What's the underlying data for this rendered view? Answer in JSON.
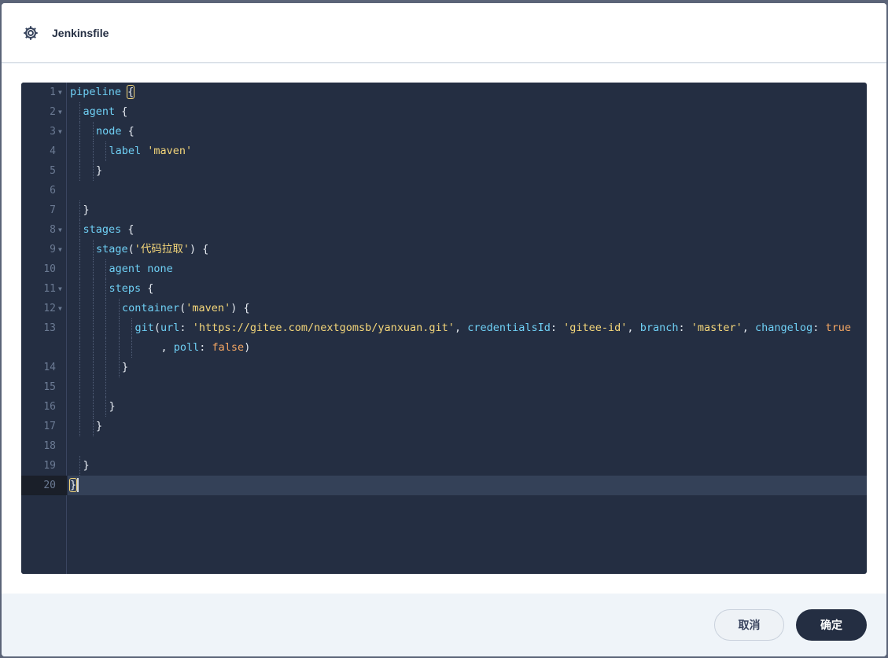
{
  "header": {
    "icon": "gear-icon",
    "title": "Jenkinsfile"
  },
  "editor": {
    "active_line": 20,
    "lines": [
      {
        "num": "1",
        "fold": true,
        "indent": 0,
        "tokens": [
          [
            "k",
            "pipeline"
          ],
          [
            "p",
            " "
          ],
          [
            "hl",
            "{"
          ]
        ]
      },
      {
        "num": "2",
        "fold": true,
        "indent": 1,
        "tokens": [
          [
            "k",
            "agent"
          ],
          [
            "p",
            " {"
          ]
        ]
      },
      {
        "num": "3",
        "fold": true,
        "indent": 2,
        "tokens": [
          [
            "k",
            "node"
          ],
          [
            "p",
            " {"
          ]
        ]
      },
      {
        "num": "4",
        "fold": false,
        "indent": 3,
        "tokens": [
          [
            "k",
            "label"
          ],
          [
            "p",
            " "
          ],
          [
            "s",
            "'maven'"
          ]
        ]
      },
      {
        "num": "5",
        "fold": false,
        "indent": 2,
        "tokens": [
          [
            "p",
            "}"
          ]
        ]
      },
      {
        "num": "6",
        "fold": false,
        "indent": 0,
        "tokens": []
      },
      {
        "num": "7",
        "fold": false,
        "indent": 1,
        "tokens": [
          [
            "p",
            "}"
          ]
        ]
      },
      {
        "num": "8",
        "fold": true,
        "indent": 1,
        "tokens": [
          [
            "k",
            "stages"
          ],
          [
            "p",
            " {"
          ]
        ]
      },
      {
        "num": "9",
        "fold": true,
        "indent": 2,
        "tokens": [
          [
            "k",
            "stage"
          ],
          [
            "p",
            "("
          ],
          [
            "s",
            "'代码拉取'"
          ],
          [
            "p",
            ") {"
          ]
        ]
      },
      {
        "num": "10",
        "fold": false,
        "indent": 3,
        "tokens": [
          [
            "k",
            "agent"
          ],
          [
            "p",
            " "
          ],
          [
            "k",
            "none"
          ]
        ]
      },
      {
        "num": "11",
        "fold": true,
        "indent": 3,
        "tokens": [
          [
            "k",
            "steps"
          ],
          [
            "p",
            " {"
          ]
        ]
      },
      {
        "num": "12",
        "fold": true,
        "indent": 4,
        "tokens": [
          [
            "k",
            "container"
          ],
          [
            "p",
            "("
          ],
          [
            "s",
            "'maven'"
          ],
          [
            "p",
            ") {"
          ]
        ]
      },
      {
        "num": "13",
        "fold": false,
        "indent": 5,
        "tokens": [
          [
            "k",
            "git"
          ],
          [
            "p",
            "("
          ],
          [
            "k",
            "url"
          ],
          [
            "p",
            ": "
          ],
          [
            "s",
            "'https://gitee.com/nextgomsb/yanxuan.git'"
          ],
          [
            "p",
            ", "
          ],
          [
            "k",
            "credentialsId"
          ],
          [
            "p",
            ": "
          ],
          [
            "s",
            "'gitee-id'"
          ],
          [
            "p",
            ", "
          ],
          [
            "k",
            "branch"
          ],
          [
            "p",
            ": "
          ],
          [
            "s",
            "'master'"
          ],
          [
            "p",
            ", "
          ],
          [
            "k",
            "changelog"
          ],
          [
            "p",
            ": "
          ],
          [
            "b",
            "true"
          ]
        ]
      },
      {
        "num": "",
        "fold": false,
        "indent": 7,
        "guides": 5,
        "tokens": [
          [
            "p",
            ", "
          ],
          [
            "k",
            "poll"
          ],
          [
            "p",
            ": "
          ],
          [
            "b",
            "false"
          ],
          [
            "p",
            ")"
          ]
        ]
      },
      {
        "num": "14",
        "fold": false,
        "indent": 4,
        "tokens": [
          [
            "p",
            "}"
          ]
        ]
      },
      {
        "num": "15",
        "fold": false,
        "indent": 0,
        "guides": 3,
        "tokens": []
      },
      {
        "num": "16",
        "fold": false,
        "indent": 3,
        "tokens": [
          [
            "p",
            "}"
          ]
        ]
      },
      {
        "num": "17",
        "fold": false,
        "indent": 2,
        "tokens": [
          [
            "p",
            "}"
          ]
        ]
      },
      {
        "num": "18",
        "fold": false,
        "indent": 0,
        "tokens": []
      },
      {
        "num": "19",
        "fold": false,
        "indent": 1,
        "tokens": [
          [
            "p",
            "}"
          ]
        ]
      },
      {
        "num": "20",
        "fold": false,
        "indent": 0,
        "tokens": [
          [
            "hl",
            "}"
          ],
          [
            "cursor",
            ""
          ]
        ]
      }
    ]
  },
  "footer": {
    "cancel_label": "取消",
    "ok_label": "确定"
  }
}
